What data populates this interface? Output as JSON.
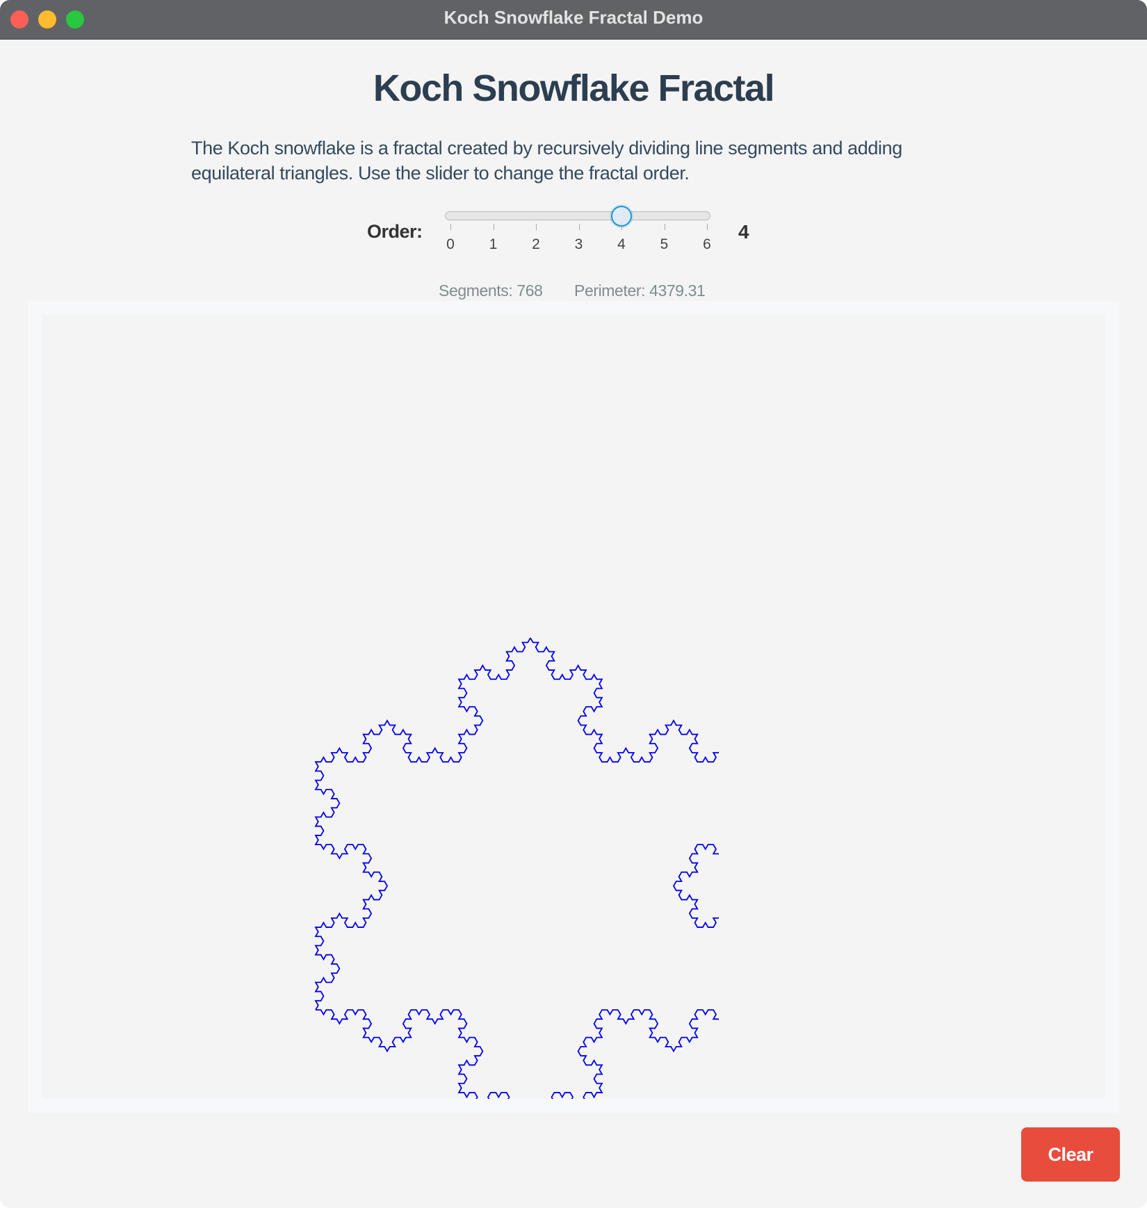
{
  "window": {
    "title": "Koch Snowflake Fractal Demo"
  },
  "header": {
    "title": "Koch Snowflake Fractal",
    "description": "The Koch snowflake is a fractal created by recursively dividing line segments and adding equilateral triangles. Use the slider to change the fractal order."
  },
  "controls": {
    "order_label": "Order:",
    "slider": {
      "min": 0,
      "max": 6,
      "value": 4,
      "tick_labels": [
        "0",
        "1",
        "2",
        "3",
        "4",
        "5",
        "6"
      ]
    },
    "order_value": "4"
  },
  "stats": {
    "segments": "Segments: 768",
    "perimeter": "Perimeter: 4379.31"
  },
  "fractal": {
    "order": 4,
    "stroke_color": "#0000ee"
  },
  "actions": {
    "clear_label": "Clear"
  },
  "colors": {
    "title_bar": "#616265",
    "title_text": "#2c3e50",
    "slider_accent": "#2196d3",
    "clear_button": "#e74c3c",
    "fractal_stroke": "#0000ee"
  }
}
